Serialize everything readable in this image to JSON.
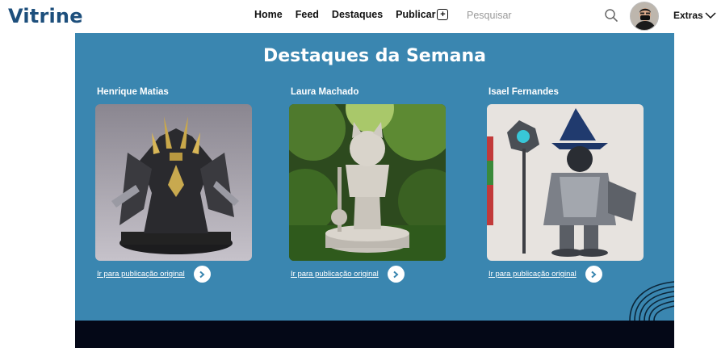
{
  "header": {
    "logo": "Vitrine",
    "nav": {
      "home": "Home",
      "feed": "Feed",
      "destaques": "Destaques",
      "publicar": "Publicar",
      "publicar_plus": "+"
    },
    "search": {
      "placeholder": "Pesquisar",
      "icon": "search-icon"
    },
    "extras": "Extras"
  },
  "main": {
    "title": "Destaques da Semana",
    "cards": [
      {
        "author": "Henrique Matias",
        "link_label": "Ir para publicação original",
        "image": "dark armored knight figurine"
      },
      {
        "author": "Laura Machado",
        "link_label": "Ir para publicação original",
        "image": "cat knight statue in garden"
      },
      {
        "author": "Isael Fernandes",
        "link_label": "Ir para publicação original",
        "image": "armored wizard with staff"
      }
    ]
  },
  "colors": {
    "brand": "#1d4f7c",
    "section_bg": "#3a86b0",
    "footer_bg": "#040817"
  }
}
